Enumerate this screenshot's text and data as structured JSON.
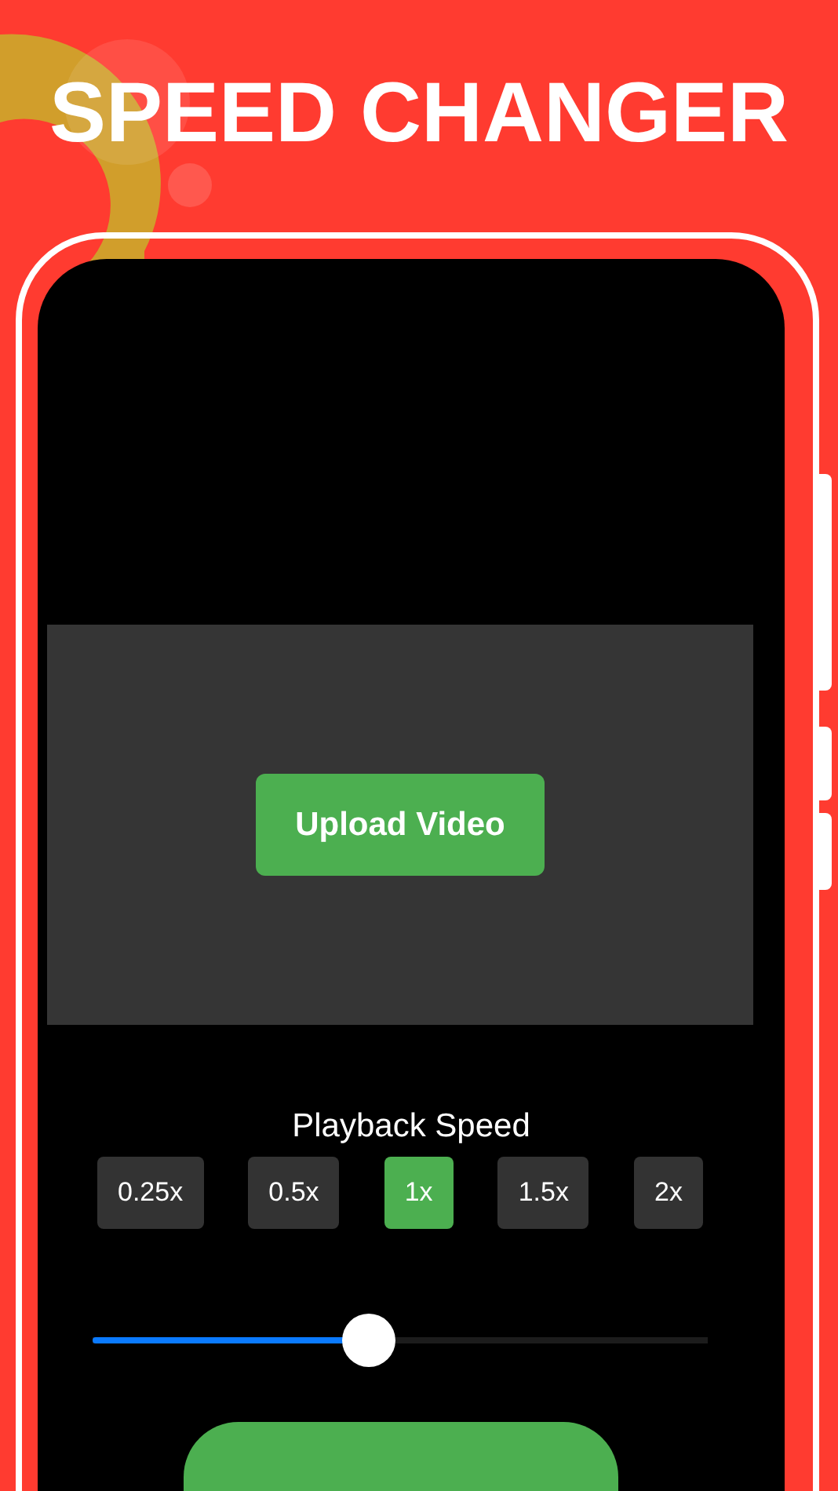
{
  "title": "SPEED CHANGER",
  "screen": {
    "upload_button": "Upload Video",
    "speed_label": "Playback Speed",
    "speeds": [
      {
        "label": "0.25x",
        "selected": false
      },
      {
        "label": "0.5x",
        "selected": false
      },
      {
        "label": "1x",
        "selected": true
      },
      {
        "label": "1.5x",
        "selected": false
      },
      {
        "label": "2x",
        "selected": false
      }
    ],
    "slider": {
      "level": 0.45
    }
  }
}
